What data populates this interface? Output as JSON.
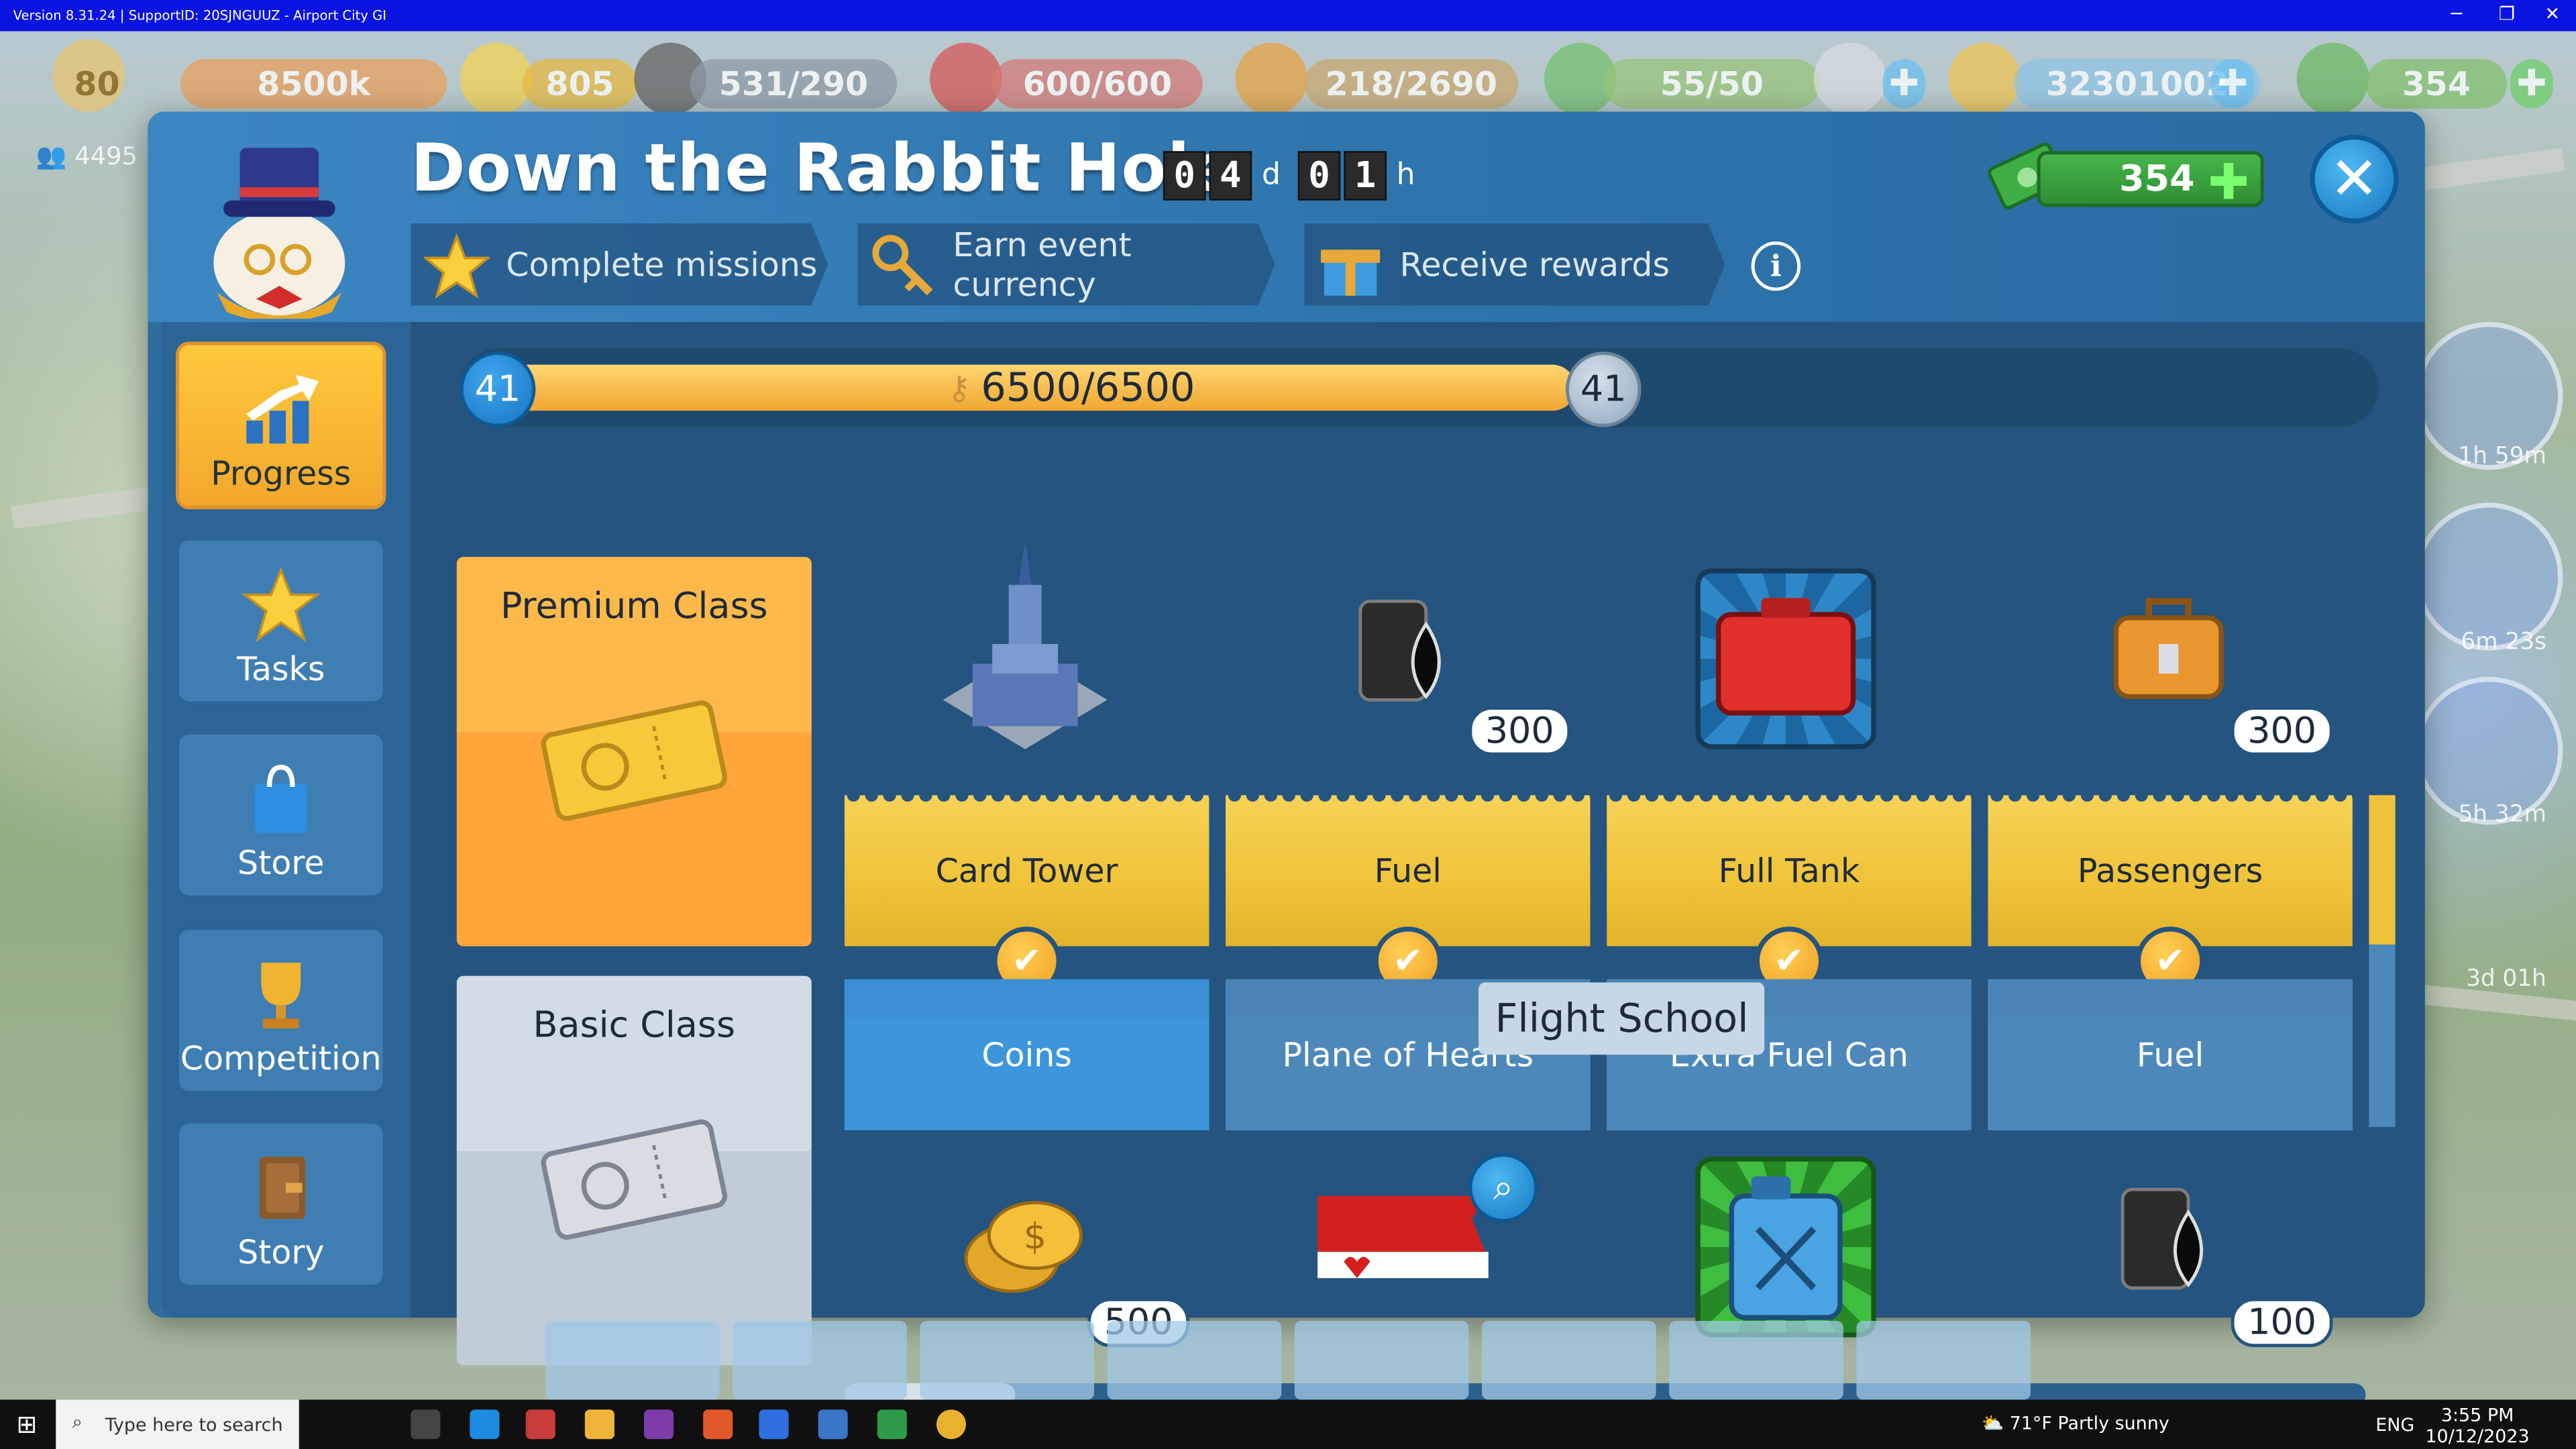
{
  "window": {
    "title": "Version 8.31.24 | SupportID: 20SJNGUUZ - Airport City GI"
  },
  "resources": {
    "level": "80",
    "xp": "8500k",
    "stars": "805",
    "fuel": "531/290",
    "cargo": "600/600",
    "passengers": "218/2690",
    "staff": "55/50",
    "coins": "32301002",
    "cash": "354",
    "population": "4495"
  },
  "side_timers": [
    "1h 59m",
    "6m 23s",
    "5h 32m",
    "3d 01h"
  ],
  "event": {
    "title": "Down the Rabbit Hole",
    "timer": {
      "days_digits": [
        "0",
        "4"
      ],
      "days_unit": "d",
      "hours_digits": [
        "0",
        "1"
      ],
      "hours_unit": "h"
    },
    "steps": [
      {
        "label": "Complete missions",
        "icon": "star-icon"
      },
      {
        "label": "Earn event currency",
        "icon": "key-icon"
      },
      {
        "label": "Receive rewards",
        "icon": "gift-icon"
      }
    ],
    "info_symbol": "i",
    "cash": "354",
    "close_symbol": "✕"
  },
  "nav": [
    {
      "label": "Progress",
      "icon": "progress-chart-icon",
      "active": true
    },
    {
      "label": "Tasks",
      "icon": "star-icon",
      "active": false
    },
    {
      "label": "Store",
      "icon": "shopping-bag-icon",
      "active": false
    },
    {
      "label": "Competition",
      "icon": "trophy-icon",
      "active": false
    },
    {
      "label": "Story",
      "icon": "book-icon",
      "active": false
    }
  ],
  "progress": {
    "current_level": "41",
    "next_level": "41",
    "text": "6500/6500",
    "fraction": 0.6
  },
  "classes": {
    "premium": "Premium Class",
    "basic": "Basic Class"
  },
  "rewards": [
    {
      "premium": {
        "label": "Card Tower",
        "icon": "card-tower-building-icon",
        "qty": ""
      },
      "basic": {
        "label": "Coins",
        "icon": "coins-icon",
        "qty": "500"
      }
    },
    {
      "premium": {
        "label": "Fuel",
        "icon": "fuel-barrel-icon",
        "qty": "300"
      },
      "basic": {
        "label": "Plane of Hearts",
        "icon": "plane-of-hearts-icon",
        "qty": ""
      }
    },
    {
      "premium": {
        "label": "Full Tank",
        "icon": "red-fuel-tank-icon",
        "qty": ""
      },
      "basic": {
        "label": "Extra Fuel Can",
        "icon": "jerry-can-icon",
        "qty": ""
      }
    },
    {
      "premium": {
        "label": "Passengers",
        "icon": "suitcase-icon",
        "qty": "300"
      },
      "basic": {
        "label": "Fuel",
        "icon": "fuel-barrel-icon",
        "qty": "100"
      }
    }
  ],
  "tooltip": "Flight School",
  "taskbar": {
    "search_placeholder": "Type here to search",
    "weather": "71°F  Partly sunny",
    "lang": "ENG",
    "time": "3:55 PM",
    "date": "10/12/2023"
  }
}
